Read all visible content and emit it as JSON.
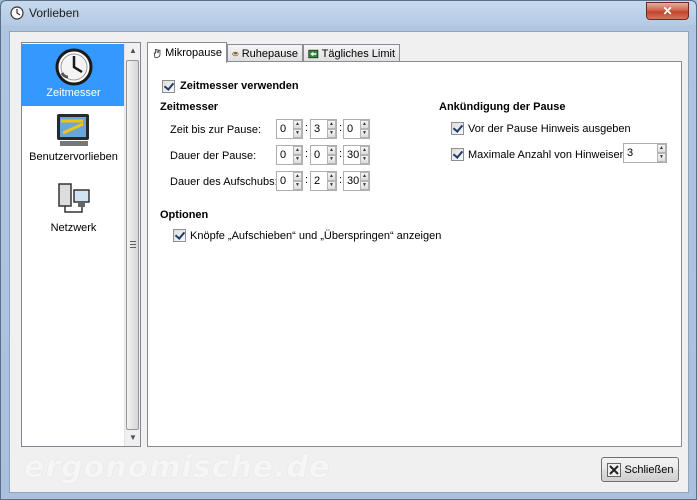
{
  "window": {
    "title": "Vorlieben",
    "close_glyph": "✕"
  },
  "sidebar": {
    "items": [
      {
        "label": "Zeitmesser",
        "icon": "clock-icon",
        "active": true
      },
      {
        "label": "Benutzervorlieben",
        "icon": "preferences-icon",
        "active": false
      },
      {
        "label": "Netzwerk",
        "icon": "network-icon",
        "active": false
      }
    ]
  },
  "tabs": [
    {
      "label": "Mikropause",
      "icon": "hand-icon",
      "active": true
    },
    {
      "label": "Ruhepause",
      "icon": "cup-icon",
      "active": false
    },
    {
      "label": "Tägliches Limit",
      "icon": "limit-icon",
      "active": false
    }
  ],
  "panel": {
    "use_timer_label": "Zeitmesser verwenden",
    "use_timer_checked": true,
    "timer": {
      "heading": "Zeitmesser",
      "rows": [
        {
          "label": "Zeit bis zur Pause:",
          "values": [
            "0",
            "3",
            "0"
          ]
        },
        {
          "label": "Dauer der Pause:",
          "values": [
            "0",
            "0",
            "30"
          ]
        },
        {
          "label": "Dauer des Aufschubs:",
          "values": [
            "0",
            "2",
            "30"
          ]
        }
      ],
      "separator": ":"
    },
    "announcement": {
      "heading": "Ankündigung der Pause",
      "show_hint_label": "Vor der Pause Hinweis ausgeben",
      "show_hint_checked": true,
      "max_hints_label": "Maximale Anzahl von Hinweisen:",
      "max_hints_checked": true,
      "max_hints_value": "3"
    },
    "options": {
      "heading": "Optionen",
      "buttons_label": "Knöpfe „Aufschieben“ und „Überspringen“ anzeigen",
      "buttons_checked": true
    }
  },
  "footer": {
    "close_button_label": "Schließen",
    "watermark": "ergonomische.de"
  },
  "colors": {
    "selection": "#3399ff",
    "titlebar": "#b4cbe4",
    "close": "#c3442b"
  }
}
